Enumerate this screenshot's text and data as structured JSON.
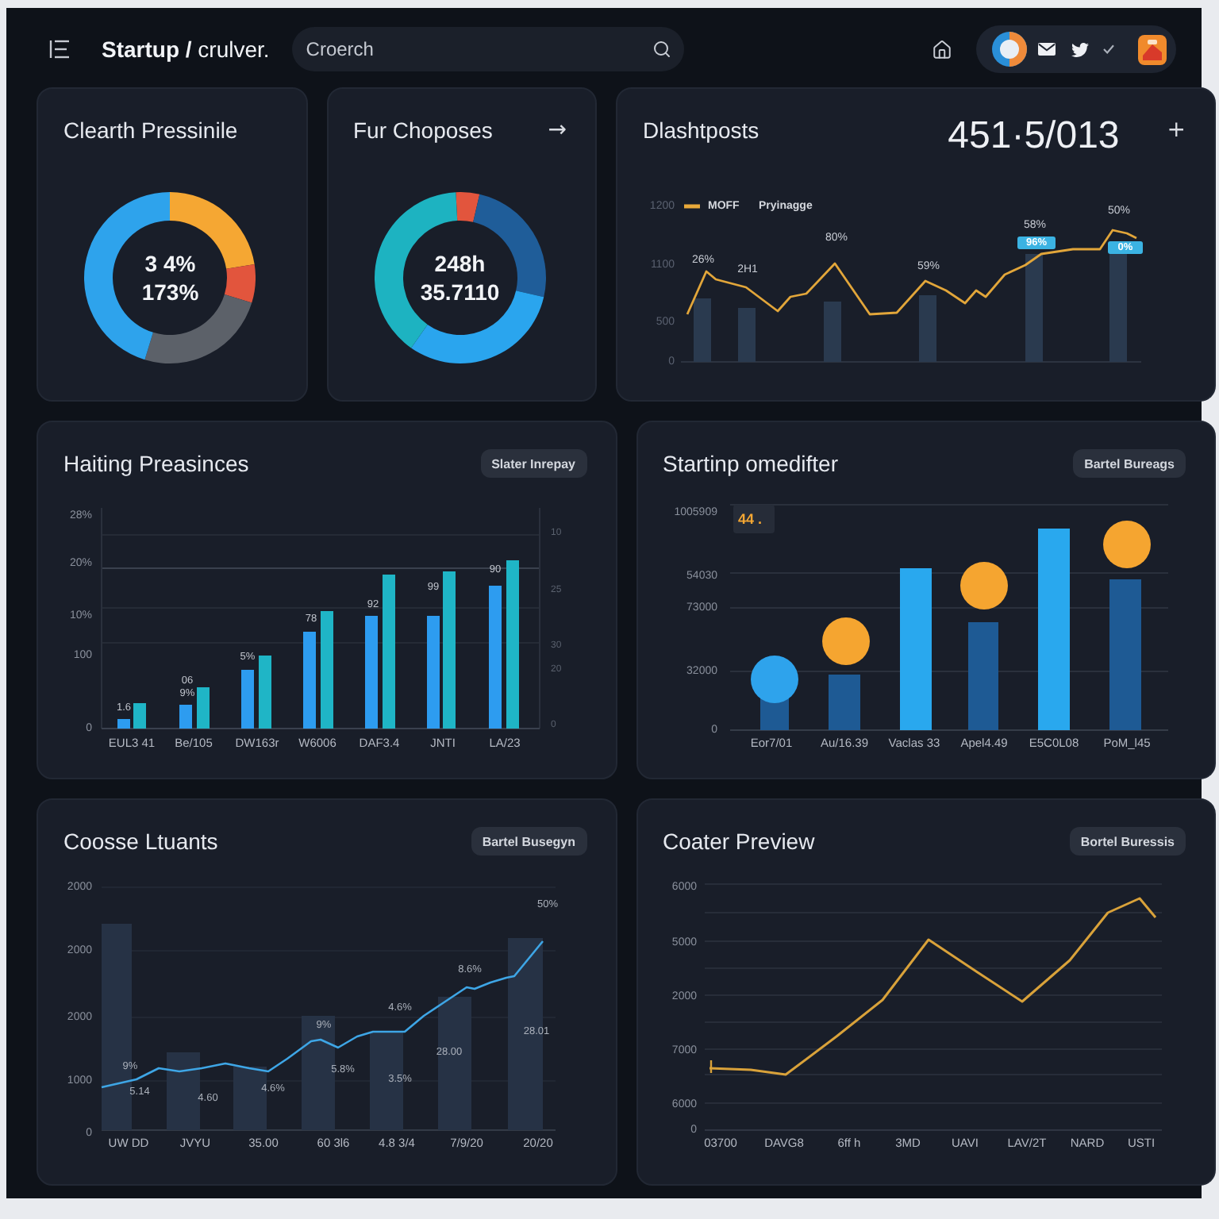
{
  "top_bar": {
    "breadcrumb": "**Startup /** crulver.",
    "search": {
      "placeholder": "Croerch"
    }
  },
  "rows": [
    [
      {
        "kind": "donut",
        "title": "Clearth Pressinile",
        "center_lines": [
          "3 4%",
          "173%"
        ]
      },
      {
        "kind": "donut",
        "title": "Fur Choposes",
        "action": "→",
        "center_lines": [
          "248h",
          "35.7110"
        ]
      },
      {
        "kind": "trend",
        "title": "Dlashtposts",
        "total": "451·5/013",
        "action": "+",
        "y_ticks": [
          "1200",
          "1100",
          "500",
          "0"
        ],
        "legend": [
          "MOFF",
          "Pryinagge"
        ],
        "point_labels": [
          "26%",
          "2H1",
          "80%",
          "59%",
          "58%",
          "50%"
        ],
        "badges": [
          "96%",
          "0%"
        ]
      }
    ],
    [
      {
        "kind": "grouped_bars",
        "title": "Haiting Preasinces",
        "button": "Slater Inrepay",
        "y_ticks": [
          "28%",
          "20%",
          "10%",
          "100",
          "0"
        ],
        "y2_ticks": [
          "10",
          "25",
          "30",
          "20",
          "0"
        ],
        "value_labels": [
          "1.6",
          "06",
          "9%",
          "5%",
          "78",
          "92",
          "99",
          "90"
        ],
        "x_labels": [
          "EUL3 41",
          "Be/105",
          "DW163r",
          "W6006",
          "DAF3.4",
          "JNTI",
          "LA/23"
        ]
      },
      {
        "kind": "bubble_bars",
        "title": "Startinp omedifter",
        "button": "Bartel Bureags",
        "y_ticks": [
          "1005909",
          "54030",
          "73000",
          "32000",
          "0"
        ],
        "callout": "44 .",
        "x_labels": [
          "Eor7/01",
          "Au/16.39",
          "Vaclas 33",
          "Apel4.49",
          "E5C0L08",
          "PoM_l45"
        ]
      }
    ],
    [
      {
        "kind": "bars_line",
        "title": "Coosse Ltuants",
        "button": "Bartel Busegyn",
        "y_ticks": [
          "2000",
          "2000",
          "2000",
          "1000",
          "0"
        ],
        "value_labels": [
          "9%",
          "5.14",
          "4.60",
          "4.6%",
          "9%",
          "5.8%",
          "4.6%",
          "3.5%",
          "28.00",
          "8.6%",
          "28.01",
          "50%"
        ],
        "x_labels": [
          "UW DD",
          "JVYU",
          "35.00",
          "60 3l6",
          "4.8 3/4",
          "7/9/20",
          "20/20"
        ]
      },
      {
        "kind": "line",
        "title": "Coater Preview",
        "button": "Bortel Buressis",
        "y_ticks": [
          "6000",
          "5000",
          "2000",
          "7000",
          "6000",
          "0"
        ],
        "x_labels": [
          "03700",
          "DAVG8",
          "6ff h",
          "3MD",
          "UAVI",
          "LAV/2T",
          "NARD",
          "USTI"
        ]
      }
    ]
  ]
}
